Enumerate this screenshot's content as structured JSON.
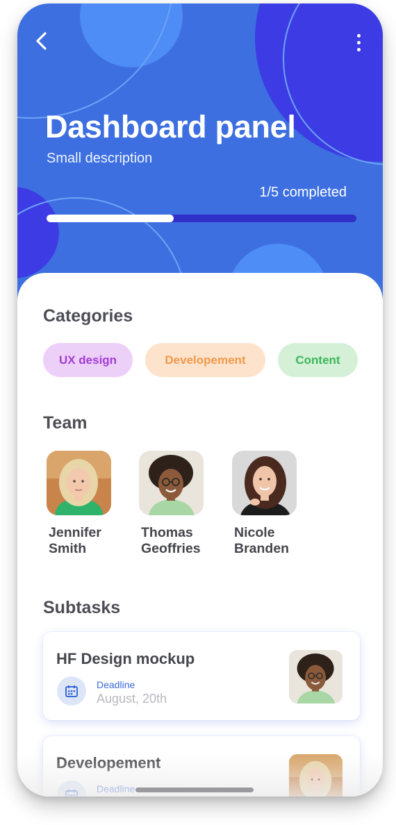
{
  "header": {
    "back_icon": "chevron-left-icon",
    "menu_icon": "more-vertical-icon",
    "title": "Dashboard panel",
    "subtitle": "Small description",
    "progress_text": "1/5 completed",
    "progress_fraction": 0.41,
    "colors": {
      "background": "#3d6fe0",
      "track": "#3030c8",
      "fill": "#ffffff"
    }
  },
  "categories": {
    "title": "Categories",
    "items": [
      {
        "label": "UX design",
        "bg": "#ecd0f8",
        "color": "#a33bd4"
      },
      {
        "label": "Developement",
        "bg": "#fde3cc",
        "color": "#ef9a4b"
      },
      {
        "label": "Content",
        "bg": "#d4f1d7",
        "color": "#3cb55a"
      }
    ]
  },
  "team": {
    "title": "Team",
    "members": [
      {
        "first": "Jennifer",
        "last": "Smith"
      },
      {
        "first": "Thomas",
        "last": "Geoffries"
      },
      {
        "first": "Nicole",
        "last": "Branden"
      }
    ]
  },
  "subtasks": {
    "title": "Subtasks",
    "items": [
      {
        "title": "HF Design mockup",
        "deadline_label": "Deadline",
        "deadline": "August, 20th"
      },
      {
        "title": "Developement",
        "deadline_label": "Deadline",
        "deadline": ""
      }
    ]
  }
}
